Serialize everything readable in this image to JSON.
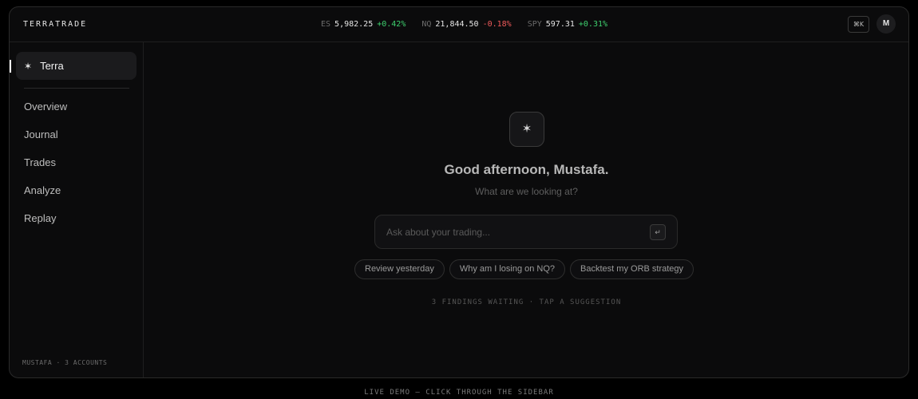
{
  "header": {
    "brand": "TERRATRADE",
    "tickers": [
      {
        "symbol": "ES",
        "price": "5,982.25",
        "change": "+0.42%",
        "direction": "up"
      },
      {
        "symbol": "NQ",
        "price": "21,844.50",
        "change": "-0.18%",
        "direction": "down"
      },
      {
        "symbol": "SPY",
        "price": "597.31",
        "change": "+0.31%",
        "direction": "up"
      }
    ],
    "shortcut": "⌘K",
    "avatar_initial": "M"
  },
  "sidebar": {
    "active_item": {
      "label": "Terra",
      "icon": "sparkle-icon"
    },
    "items": [
      {
        "label": "Overview"
      },
      {
        "label": "Journal"
      },
      {
        "label": "Trades"
      },
      {
        "label": "Analyze"
      },
      {
        "label": "Replay"
      }
    ],
    "footer": "MUSTAFA · 3 ACCOUNTS"
  },
  "main": {
    "logo_icon": "sparkle-icon",
    "greeting": "Good afternoon, Mustafa.",
    "subtitle": "What are we looking at?",
    "ask_placeholder": "Ask about your trading...",
    "enter_icon": "enter-icon",
    "suggestions": [
      "Review yesterday",
      "Why am I losing on NQ?",
      "Backtest my ORB strategy"
    ],
    "status": "3 FINDINGS WAITING · TAP A SUGGESTION"
  },
  "bottom_note": "LIVE DEMO — CLICK THROUGH THE SIDEBAR",
  "colors": {
    "background": "#000000",
    "panel": "#0b0b0c",
    "positive": "#3ecf6e",
    "negative": "#ef5a5a"
  }
}
